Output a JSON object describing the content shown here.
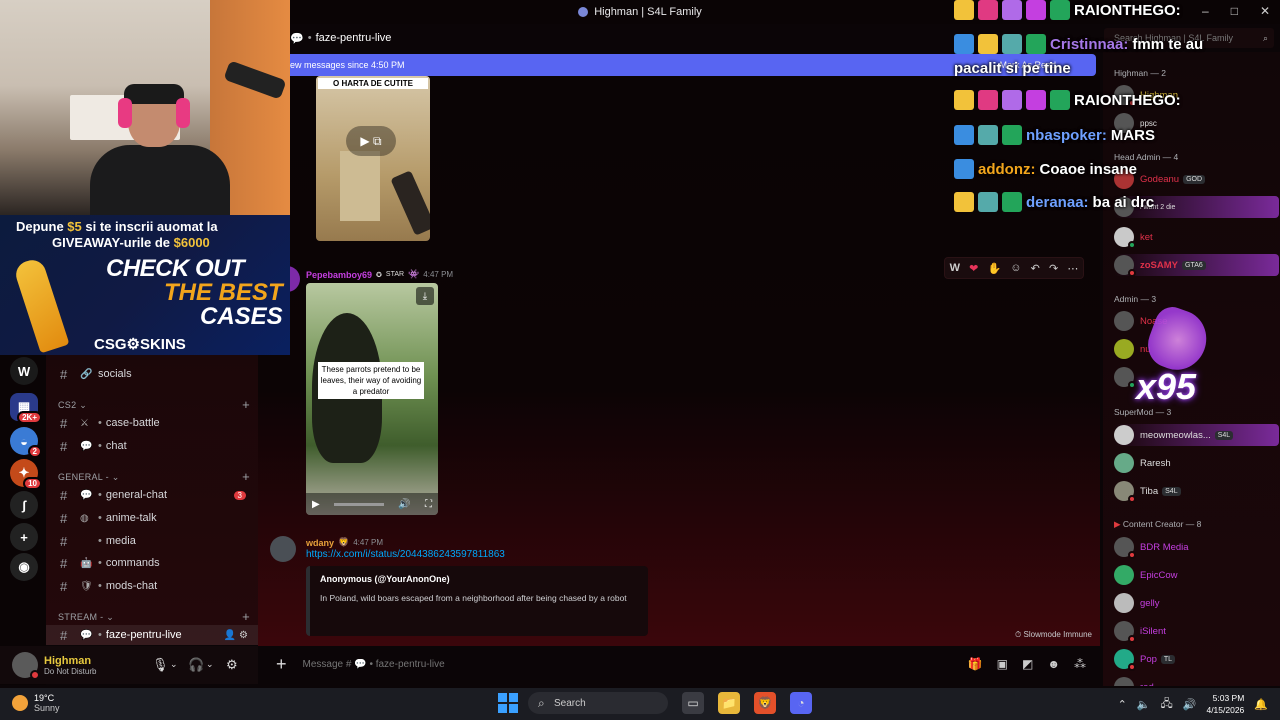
{
  "window": {
    "title": "Highman | S4L Family"
  },
  "stream_ad": {
    "line1_prefix": "Depune",
    "line1_amount": "$5",
    "line1_suffix": "si te inscrii auomat la",
    "line2_prefix": "GIVEAWAY-urile de",
    "line2_amount": "$6000",
    "check_out": "CHECK   OUT",
    "the_best": "THE BEST",
    "cases": "CASES",
    "brand": "CSG⚙SKINS"
  },
  "server_rail": [
    {
      "icon": "W",
      "color": "#1a1a1a",
      "badge": ""
    },
    {
      "icon": "▦",
      "color": "#2a3a8a",
      "badge": "2K+"
    },
    {
      "icon": "◒",
      "color": "#3a7bd5",
      "badge": "2"
    },
    {
      "icon": "✦",
      "color": "#c44a1a",
      "badge": "10"
    },
    {
      "icon": "ʃ",
      "color": "#222",
      "badge": ""
    },
    {
      "icon": "+",
      "color": "#222",
      "badge": ""
    },
    {
      "icon": "◉",
      "color": "#222",
      "badge": ""
    }
  ],
  "channel_list": {
    "socials": "socials",
    "cat_cs2": "CS2",
    "case_battle": "case-battle",
    "chat": "chat",
    "cat_general": "GENERAL -",
    "general_chat": "general-chat",
    "general_chat_badge": "3",
    "anime_talk": "anime-talk",
    "media": "media",
    "commands": "commands",
    "mods_chat": "mods-chat",
    "cat_stream": "STREAM -",
    "faze_pentru_live": "faze-pentru-live"
  },
  "user_panel": {
    "name": "Highman",
    "status": "Do Not Disturb"
  },
  "channel_header": {
    "name": "faze-pentru-live"
  },
  "new_messages_banner": {
    "text": "ew messages since 4:50 PM",
    "mark_label": "Mark As Read"
  },
  "messages": {
    "video1_caption": "O HARTA DE CUTITE",
    "msg2_user": "Pepebamboy69",
    "msg2_tag": "STAR",
    "msg2_time": "4:47 PM",
    "video2_caption": "These parrots pretend to be leaves, their way of avoiding a predator",
    "msg3_user": "wdany",
    "msg3_time": "4:47 PM",
    "msg3_link": "https://x.com/i/status/2044386243597811863",
    "embed_author": "Anonymous (@YourAnonOne)",
    "embed_desc": "In Poland, wild boars escaped from a neighborhood after being chased by a robot",
    "slowmode": "Slowmode Immune"
  },
  "composer": {
    "placeholder": "Message # 💬 • faze-pentru-live"
  },
  "member_search": {
    "placeholder": "Search Highman | S4L Family"
  },
  "members": {
    "role_highman": "Highman — 2",
    "m_highman": "Highman",
    "m_ppsc": "ppsc",
    "role_headadmin": "Head Admin — 4",
    "m_godeanu": "Godeanu",
    "m_godeanu_tag": "GOD",
    "m_want": "i want 2 die",
    "m_ket": "ket",
    "m_zosamy": "zoSAMY",
    "m_zosamy_tag": "GTA6",
    "role_admin": "Admin — 3",
    "m_noase": "Noase",
    "m_nu": "nu",
    "role_supermod": "SuperMod — 3",
    "m_meow": "meowmeowlas...",
    "m_meow_tag": "S4L",
    "m_raresh": "Raresh",
    "m_tiba": "Tiba",
    "m_tiba_tag": "S4L",
    "role_creator": "Content Creator — 8",
    "m_bdr": "BDR Media",
    "m_epic": "EpicCow",
    "m_gelly": "gelly",
    "m_silent": "iSilent",
    "m_pop": "Pop",
    "m_pop_tag": "TL",
    "m_red": "red"
  },
  "stream_chat": [
    {
      "user": "RAIONTHEGO:",
      "text": "",
      "user_color": "#ffffff"
    },
    {
      "user": "Cristinnaa:",
      "text": "fmm te au",
      "user_color": "#a678e8"
    },
    {
      "user": "",
      "text": "pacalit si pe tine",
      "user_color": "#ffffff"
    },
    {
      "user": "RAIONTHEGO:",
      "text": "",
      "user_color": "#ffffff"
    },
    {
      "user": "nbaspoker:",
      "text": "MARS",
      "user_color": "#6fa0ff"
    },
    {
      "user": "addonz:",
      "text": "Coaoe insane",
      "user_color": "#f2a51c"
    },
    {
      "user": "deranaa:",
      "text": "ba ai drc",
      "user_color": "#6fa0ff"
    }
  ],
  "alert": {
    "count": "x95"
  },
  "taskbar": {
    "temp": "19°C",
    "weather": "Sunny",
    "search": "Search",
    "time": "5:03 PM",
    "date": "4/15/2026"
  },
  "colors": {
    "accent": "#5865f2",
    "link": "#00a8fc",
    "dnd": "#e03a3e"
  }
}
